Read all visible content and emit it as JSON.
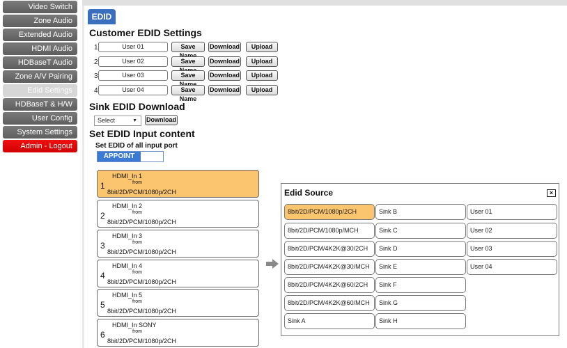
{
  "sidebar": {
    "items": [
      {
        "label": "Video Switch"
      },
      {
        "label": "Zone Audio"
      },
      {
        "label": "Extended Audio"
      },
      {
        "label": "HDMI Audio"
      },
      {
        "label": "HDBaseT Audio"
      },
      {
        "label": "Zone A/V Pairing"
      },
      {
        "label": "Edid Settings"
      },
      {
        "label": "HDBaseT & H/W Info"
      },
      {
        "label": "User Config"
      },
      {
        "label": "System Settings"
      },
      {
        "label": "Admin - Logout"
      }
    ],
    "active_index": 6
  },
  "tab": {
    "label": "EDID"
  },
  "customer": {
    "title": "Customer EDID Settings",
    "save_label": "Save Name",
    "download_label": "Download",
    "upload_label": "Upload",
    "rows": [
      {
        "num": "1",
        "name": "User 01"
      },
      {
        "num": "2",
        "name": "User 02"
      },
      {
        "num": "3",
        "name": "User 03"
      },
      {
        "num": "4",
        "name": "User 04"
      }
    ]
  },
  "sink": {
    "title": "Sink EDID Download",
    "select_value": "Select",
    "download_label": "Download"
  },
  "input_content": {
    "title": "Set EDID Input content",
    "all_label": "Set EDID of all input port",
    "toggle_label": "APPOINT",
    "from_label": "from",
    "ports": [
      {
        "num": "1",
        "name": "HDMI_In 1",
        "source": "8bit/2D/PCM/1080p/2CH",
        "selected": true
      },
      {
        "num": "2",
        "name": "HDMI_In 2",
        "source": "8bit/2D/PCM/1080p/2CH",
        "selected": false
      },
      {
        "num": "3",
        "name": "HDMI_In 3",
        "source": "8bit/2D/PCM/1080p/2CH",
        "selected": false
      },
      {
        "num": "4",
        "name": "HDMI_In 4",
        "source": "8bit/2D/PCM/1080p/2CH",
        "selected": false
      },
      {
        "num": "5",
        "name": "HDMI_In 5",
        "source": "8bit/2D/PCM/1080p/2CH",
        "selected": false
      },
      {
        "num": "6",
        "name": "HDMI_In SONY",
        "source": "8bit/2D/PCM/1080p/2CH",
        "selected": false
      }
    ]
  },
  "edid_source": {
    "title": "Edid Source",
    "close_glyph": "×",
    "columns": [
      [
        "8bit/2D/PCM/1080p/2CH",
        "8bit/2D/PCM/1080p/MCH",
        "8bit/2D/PCM/4K2K@30/2CH",
        "8bit/2D/PCM/4K2K@30/MCH",
        "8bit/2D/PCM/4K2K@60/2CH",
        "8bit/2D/PCM/4K2K@60/MCH",
        "Sink A"
      ],
      [
        "Sink B",
        "Sink C",
        "Sink D",
        "Sink E",
        "Sink F",
        "Sink G",
        "Sink H"
      ],
      [
        "User 01",
        "User 02",
        "User 03",
        "User 04"
      ]
    ],
    "selected": "8bit/2D/PCM/1080p/2CH"
  },
  "colors": {
    "accent": "#3a6fbf",
    "selected": "#fbc570",
    "logout": "#e00000",
    "nav": "#6a6a6a"
  }
}
